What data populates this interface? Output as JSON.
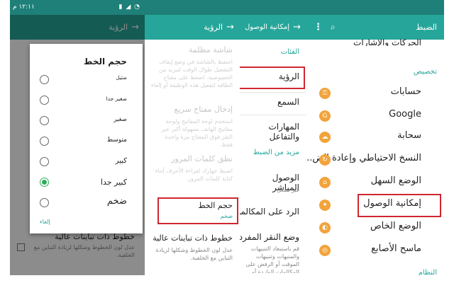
{
  "status": {
    "time": "١٢:١١ م",
    "icons": "▮ ◢ ◔"
  },
  "panel1": {
    "title": "الرؤية",
    "behind_title": "خطوط ذات تباينات عالية",
    "behind_desc": "عدل لون الخطوط وشكلها لزيادة التباين مع الخلفية.",
    "dialog": {
      "title": "حجم الخط",
      "options": [
        "ضئيل",
        "صغير جدا",
        "صغير",
        "متوسط",
        "كبير",
        "كبير جدا",
        "ضخم"
      ],
      "selected_index": 5,
      "cancel": "إلغاء"
    }
  },
  "panel2": {
    "title": "الرؤية",
    "items": [
      {
        "title": "شاشة مظلمة",
        "desc": "احتفظ بالشاشة في وضع إيقاف التشغيل طوال الوقت لمزيد من الخصوصية. اضغط على مفتاح الطاقة لتفعيل هذه الوظيفة أو إلغاء تفعيلها."
      },
      {
        "title": "إدخال مفتاح سريع",
        "desc": "استخدم لوحة المفاتيح ولوحة مفاتيح الهاتف بسهولة أكبر عبر النقر فوق المفتاح مرة واحدة فقط."
      },
      {
        "title": "نطق كلمات المرور",
        "desc": "اضبط جهازك لقراءة الأحرف أثناء كتابة كلمات المرور."
      },
      {
        "title": "حجم الخط",
        "desc": "ضخم"
      },
      {
        "title": "خطوط ذات تباينات عالية",
        "desc": "عدل لون الخطوط وشكلها لزيادة التباين مع الخلفية."
      }
    ]
  },
  "panel3": {
    "title": "إمكانية الوصول",
    "section_categories": "الفئات",
    "categories": [
      "الرؤية",
      "السمع",
      "المهارات والتفاعل"
    ],
    "section_more": "مزيد من الضبط",
    "more_items": [
      {
        "title": "الوصول المباشر",
        "desc": "غير مفعل"
      },
      {
        "title": "الرد على المكالمات وإنهاؤها",
        "desc": ""
      },
      {
        "title": "وضع النقر المفرد",
        "desc": "قم باستبعاد التنبيهات والمنبهات وتنبيهات الموقت أو الرفض على المكالمات الواردة أو ارفضها بنقرة واحدة."
      }
    ]
  },
  "panel4": {
    "title": "الضبط",
    "top_partial": "الحركات والإشارات",
    "section_custom": "تخصيص",
    "items": [
      {
        "label": "حسابات",
        "icon": "key-icon",
        "glyph": "⚿"
      },
      {
        "label": "Google",
        "icon": "google-icon",
        "glyph": "G"
      },
      {
        "label": "سحابة",
        "icon": "cloud-icon",
        "glyph": "☁"
      },
      {
        "label": "النسخ الاحتياطي وإعادة الض..",
        "icon": "backup-icon",
        "glyph": "↻"
      },
      {
        "label": "الوضع السهل",
        "icon": "easy-mode-icon",
        "glyph": "⌂"
      },
      {
        "label": "إمكانية الوصول",
        "icon": "accessibility-icon",
        "glyph": "✦"
      },
      {
        "label": "الوضع الخاص",
        "icon": "private-mode-icon",
        "glyph": "◐"
      },
      {
        "label": "ماسح الأصابع",
        "icon": "fingerprint-icon",
        "glyph": "◎"
      }
    ],
    "section_bottom": "النظام"
  }
}
